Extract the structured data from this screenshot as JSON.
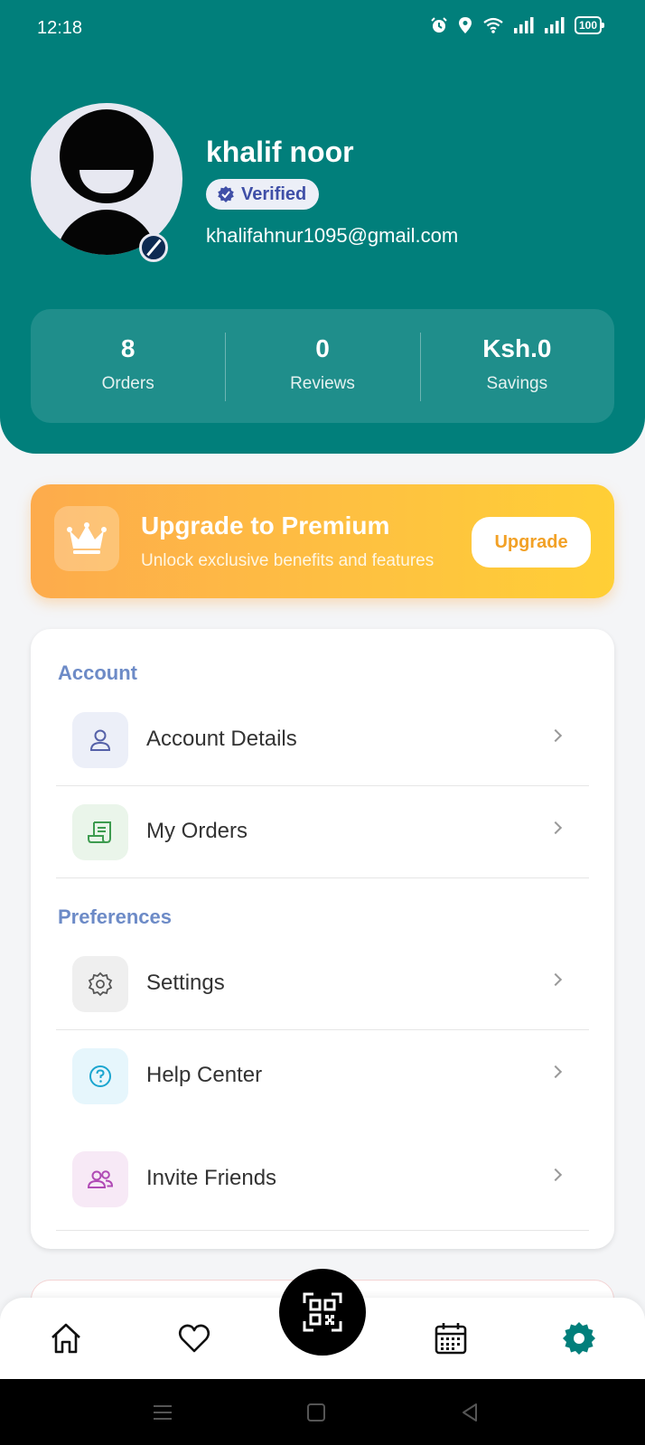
{
  "status_bar": {
    "time": "12:18",
    "battery": "100",
    "icons": [
      "alarm-icon",
      "location-icon",
      "wifi-icon",
      "signal-icon",
      "signal-icon",
      "battery-icon"
    ]
  },
  "profile": {
    "name": "khalif noor",
    "verified_label": "Verified",
    "email": "khalifahnur1095@gmail.com"
  },
  "stats": [
    {
      "value": "8",
      "label": "Orders"
    },
    {
      "value": "0",
      "label": "Reviews"
    },
    {
      "value": "Ksh.0",
      "label": "Savings"
    }
  ],
  "premium": {
    "title": "Upgrade to Premium",
    "subtitle": "Unlock exclusive benefits and features",
    "button": "Upgrade"
  },
  "sections": {
    "account": {
      "title": "Account",
      "items": [
        {
          "label": "Account Details",
          "icon": "user-icon"
        },
        {
          "label": "My Orders",
          "icon": "receipt-icon"
        }
      ]
    },
    "preferences": {
      "title": "Preferences",
      "items": [
        {
          "label": "Settings",
          "icon": "gear-icon"
        },
        {
          "label": "Help Center",
          "icon": "help-icon"
        },
        {
          "label": "Invite Friends",
          "icon": "users-icon"
        }
      ]
    }
  },
  "bottom_nav": [
    "home-icon",
    "heart-icon",
    "qr-code-icon",
    "calendar-icon",
    "gear-icon"
  ],
  "colors": {
    "primary": "#017f7b",
    "premium_start": "#fdab4c",
    "premium_end": "#ffcf36",
    "section_title": "#6d8bc7",
    "active_nav": "#017f7b"
  }
}
